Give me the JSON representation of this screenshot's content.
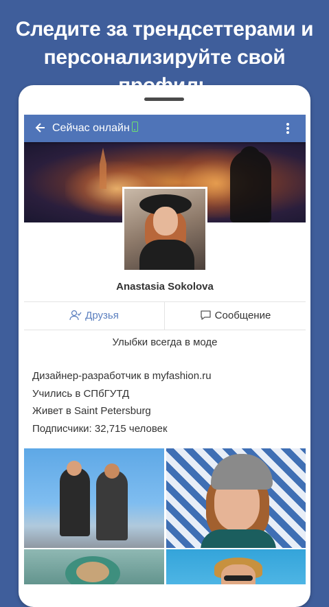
{
  "headline": {
    "line1": "Следите за трендсеттерами и",
    "line2": "персонализируйте свой профиль"
  },
  "appbar": {
    "back_icon": "arrow-left-icon",
    "title": "Сейчас онлайн",
    "online_icon": "phone-online-icon",
    "more_icon": "more-vertical-icon",
    "background": "#4f74b8",
    "online_color": "#6fe36f"
  },
  "profile": {
    "name": "Anastasia Sokolova",
    "status": "Улыбки всегда в моде"
  },
  "actions": {
    "friends_label": "Друзья",
    "friends_icon": "user-check-icon",
    "message_label": "Сообщение",
    "message_icon": "chat-bubble-icon",
    "friends_color": "#5b7fbf"
  },
  "info": {
    "job": "Дизайнер-разработчик в myfashion.ru",
    "education": "Учились в СПбГУТД",
    "city": "Живет в Saint Petersburg",
    "followers": "Подписчики: 32,715 человек"
  },
  "colors": {
    "page_background": "#3f5e9b",
    "accent": "#4f74b8"
  }
}
